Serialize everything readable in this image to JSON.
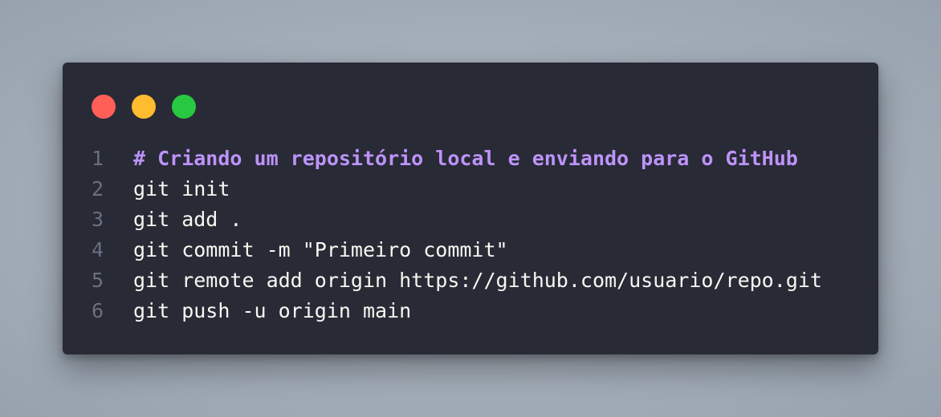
{
  "colors": {
    "window_bg": "#282a36",
    "close": "#ff5f57",
    "minimize": "#febc2e",
    "maximize": "#28c840",
    "comment": "#bd93f9",
    "text": "#f8f8f2",
    "line_number": "#6b6f82"
  },
  "window_controls": [
    {
      "name": "close-dot",
      "icon": "red-circle-icon"
    },
    {
      "name": "minimize-dot",
      "icon": "yellow-circle-icon"
    },
    {
      "name": "maximize-dot",
      "icon": "green-circle-icon"
    }
  ],
  "code": {
    "lines": [
      {
        "number": "1",
        "text": "# Criando um repositório local e enviando para o GitHub",
        "kind": "comment"
      },
      {
        "number": "2",
        "text": "git init",
        "kind": "code"
      },
      {
        "number": "3",
        "text": "git add .",
        "kind": "code"
      },
      {
        "number": "4",
        "text": "git commit -m \"Primeiro commit\"",
        "kind": "code"
      },
      {
        "number": "5",
        "text": "git remote add origin https://github.com/usuario/repo.git",
        "kind": "code"
      },
      {
        "number": "6",
        "text": "git push -u origin main",
        "kind": "code"
      }
    ]
  }
}
